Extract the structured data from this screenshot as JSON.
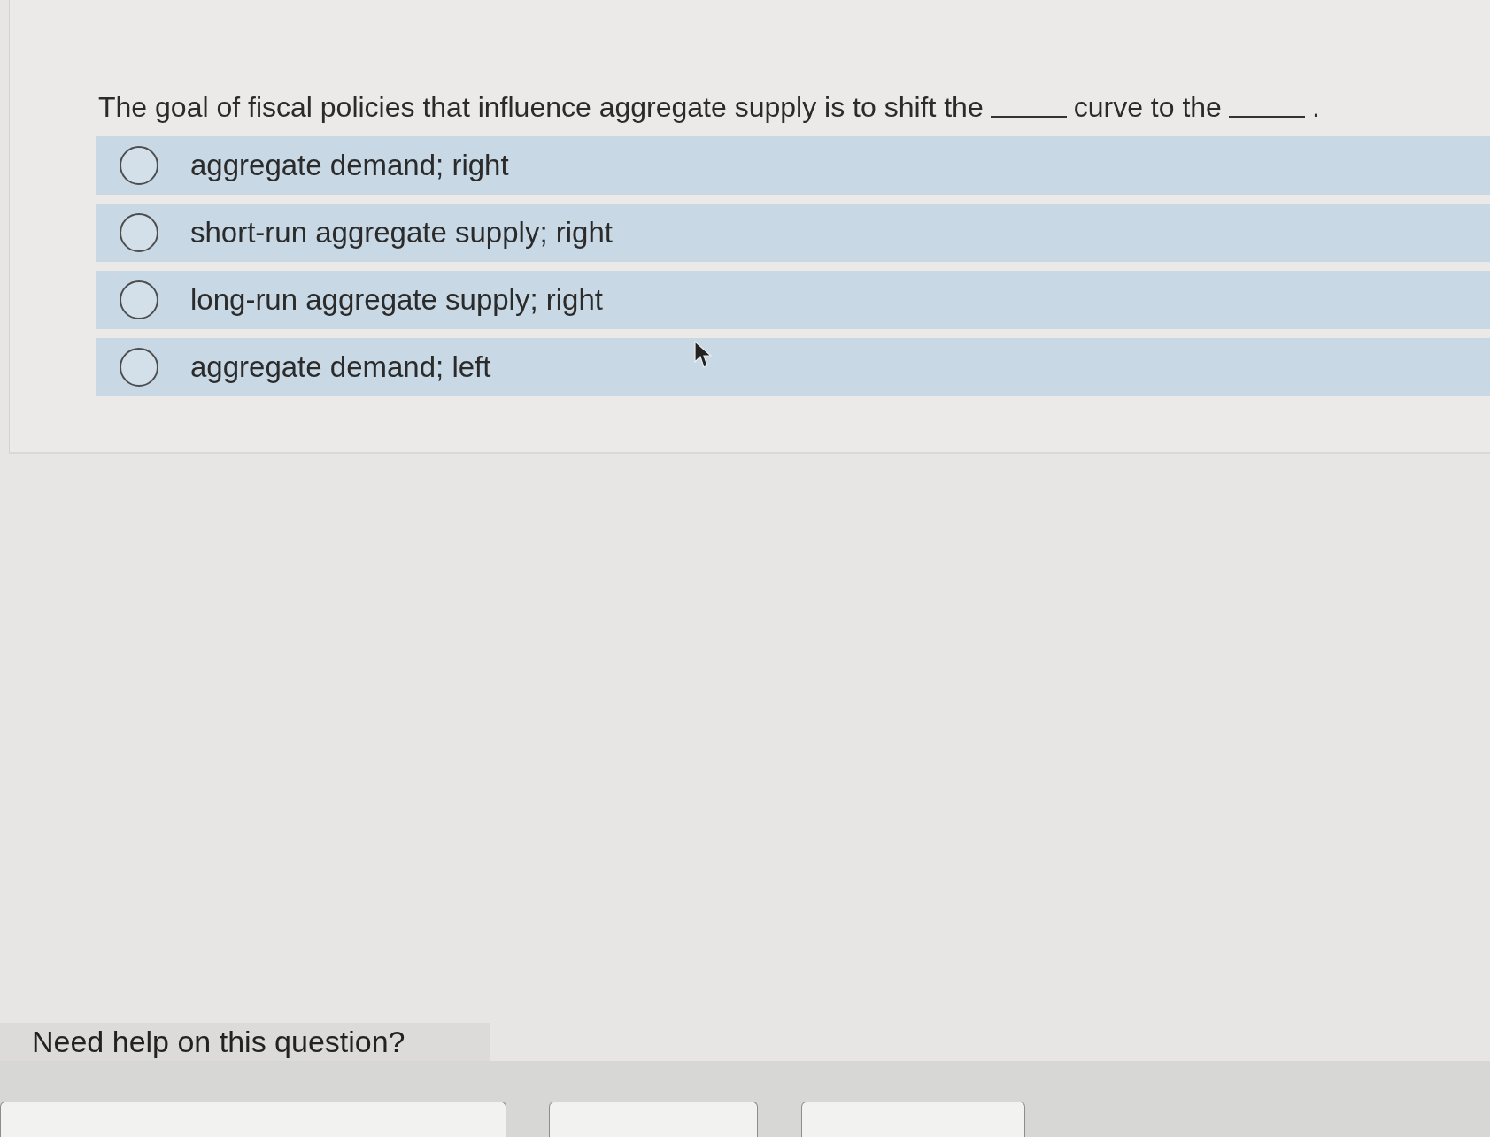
{
  "question": {
    "parts": [
      {
        "kind": "text",
        "text": "The goal of fiscal policies that influence aggregate supply is to shift the"
      },
      {
        "kind": "blank"
      },
      {
        "kind": "text",
        "text": "curve to the"
      },
      {
        "kind": "blank"
      },
      {
        "kind": "text",
        "text": "."
      }
    ]
  },
  "options": [
    {
      "label": "aggregate demand; right",
      "selected": false
    },
    {
      "label": "short-run aggregate supply; right",
      "selected": false
    },
    {
      "label": "long-run aggregate supply; right",
      "selected": false
    },
    {
      "label": "aggregate demand; left",
      "selected": false
    }
  ],
  "help": {
    "title": "Need help on this question?",
    "buttons": [
      {
        "kind": "outline"
      },
      {
        "kind": "outline"
      },
      {
        "kind": "outline"
      }
    ]
  }
}
